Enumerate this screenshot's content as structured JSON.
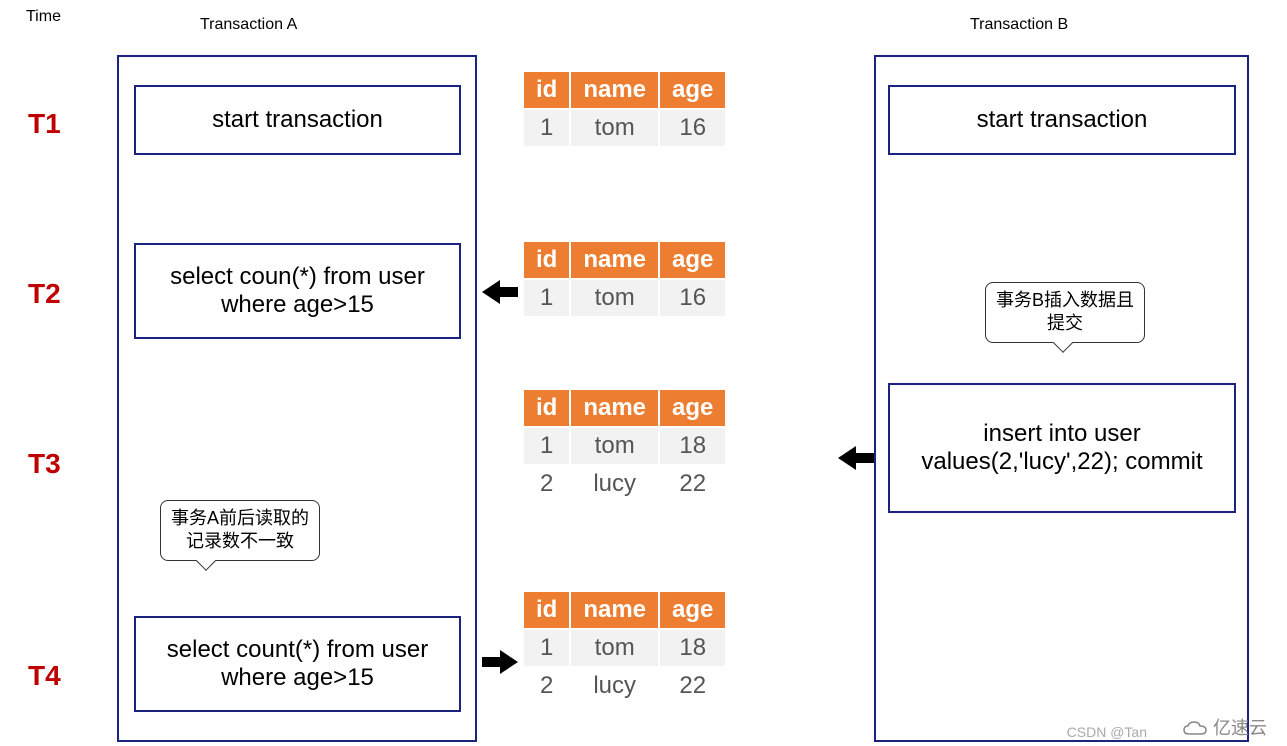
{
  "headers": {
    "time": "Time",
    "txA": "Transaction A",
    "txB": "Transaction B"
  },
  "timeLabels": [
    "T1",
    "T2",
    "T3",
    "T4"
  ],
  "txA": {
    "t1": "start transaction",
    "t2": "select coun(*) from user where age>15",
    "t4": "select count(*) from user where age>15"
  },
  "txB": {
    "t1": "start transaction",
    "t3": "insert into user values(2,'lucy',22); commit"
  },
  "tableHeaders": [
    "id",
    "name",
    "age"
  ],
  "tables": {
    "t1": [
      [
        "1",
        "tom",
        "16"
      ]
    ],
    "t2": [
      [
        "1",
        "tom",
        "16"
      ]
    ],
    "t3": [
      [
        "1",
        "tom",
        "18"
      ],
      [
        "2",
        "lucy",
        "22"
      ]
    ],
    "t4": [
      [
        "1",
        "tom",
        "18"
      ],
      [
        "2",
        "lucy",
        "22"
      ]
    ]
  },
  "speech": {
    "txA": "事务A前后读取的记录数不一致",
    "txB": "事务B插入数据且提交"
  },
  "watermark": {
    "csdn": "CSDN @Tan",
    "yisu": "亿速云"
  },
  "colors": {
    "timeLabel": "#c00000",
    "border": "#1a237e",
    "tableHeader": "#ed7d31"
  }
}
